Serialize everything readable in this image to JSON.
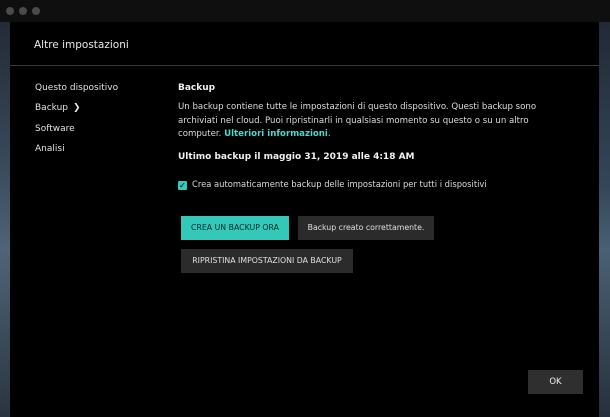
{
  "dialog": {
    "title": "Altre impostazioni"
  },
  "sidebar": {
    "items": [
      {
        "label": "Questo dispositivo",
        "active": false
      },
      {
        "label": "Backup",
        "active": true
      },
      {
        "label": "Software",
        "active": false
      },
      {
        "label": "Analisi",
        "active": false
      }
    ]
  },
  "backup": {
    "section_title": "Backup",
    "description": "Un backup contiene tutte le impostazioni di questo dispositivo. Questi backup sono archiviati nel cloud. Puoi ripristinarli in qualsiasi momento su questo o su un altro computer.",
    "more_info_link": "Ulteriori informazioni",
    "more_info_suffix": ".",
    "last_backup": "Ultimo backup il maggio 31, 2019 alle 4:18 AM",
    "auto_backup_checked": true,
    "auto_backup_label": "Crea automaticamente backup delle impostazioni per tutti i dispositivi",
    "create_button": "CREA UN BACKUP ORA",
    "status_message": "Backup creato correttamente.",
    "restore_button": "RIPRISTINA IMPOSTAZIONI DA BACKUP"
  },
  "footer": {
    "ok_button": "OK"
  },
  "colors": {
    "accent": "#33c8b8",
    "link": "#4fd6c9",
    "background": "#000000",
    "button_dark": "#2b2b2b"
  }
}
